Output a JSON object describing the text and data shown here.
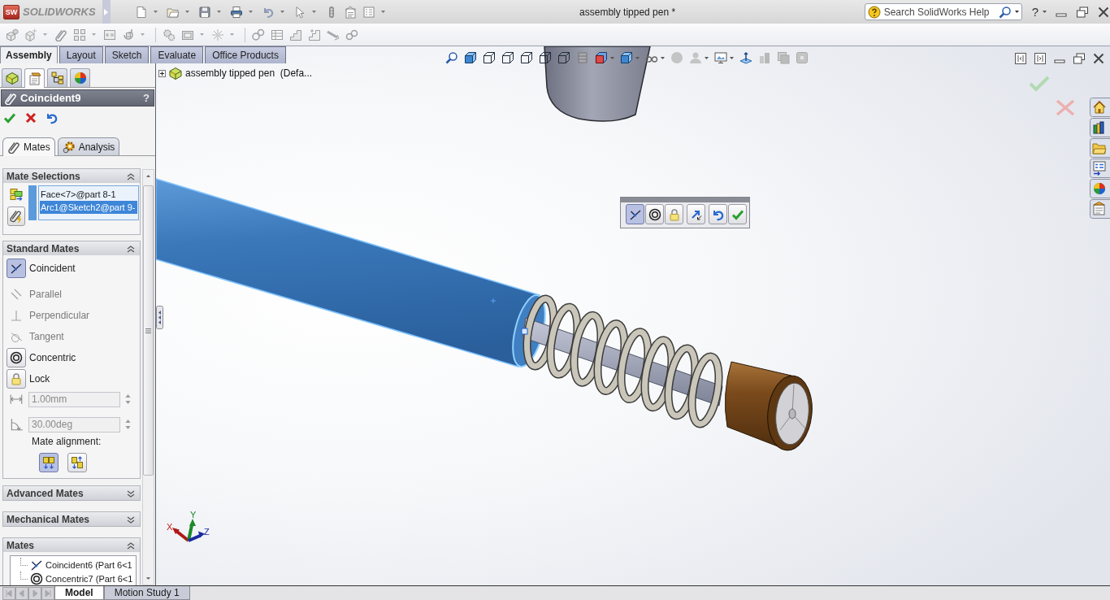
{
  "window": {
    "logo_mark": "SW",
    "brand": "SOLIDWORKS",
    "title": "assembly tipped pen *",
    "help": "?"
  },
  "help_search": {
    "placeholder": "Search SolidWorks Help"
  },
  "command_toolbar": {
    "disabled": true
  },
  "command_tabs": [
    {
      "label": "Assembly",
      "selected": true
    },
    {
      "label": "Layout",
      "selected": false
    },
    {
      "label": "Sketch",
      "selected": false
    },
    {
      "label": "Evaluate",
      "selected": false
    },
    {
      "label": "Office Products",
      "selected": false
    }
  ],
  "manager_tabs": [
    {
      "selected": false
    },
    {
      "selected": true
    },
    {
      "selected": false
    },
    {
      "selected": false
    }
  ],
  "property_manager": {
    "title": "Coincident9",
    "help": "?",
    "tabs": [
      {
        "label": "Mates",
        "selected": true
      },
      {
        "label": "Analysis",
        "selected": false
      }
    ],
    "mate_selections": {
      "title": "Mate Selections",
      "expanded": true,
      "items": [
        {
          "text": "Face<7>@part 8-1",
          "selected": false
        },
        {
          "text": "Arc1@Sketch2@part 9-",
          "selected": true
        }
      ]
    },
    "standard_mates": {
      "title": "Standard Mates",
      "expanded": true,
      "options": [
        {
          "kind": "coincident",
          "label": "Coincident",
          "selected": true,
          "disabled": false
        },
        {
          "kind": "parallel",
          "label": "Parallel",
          "selected": false,
          "disabled": true
        },
        {
          "kind": "perpendicular",
          "label": "Perpendicular",
          "selected": false,
          "disabled": true
        },
        {
          "kind": "tangent",
          "label": "Tangent",
          "selected": false,
          "disabled": true
        },
        {
          "kind": "concentric",
          "label": "Concentric",
          "selected": false,
          "disabled": false
        },
        {
          "kind": "lock",
          "label": "Lock",
          "selected": false,
          "disabled": false
        }
      ],
      "distance": {
        "value": "1.00mm",
        "disabled": true
      },
      "angle": {
        "value": "30.00deg",
        "disabled": true
      },
      "alignment_label": "Mate alignment:",
      "alignment": [
        {
          "kind": "aligned",
          "selected": true
        },
        {
          "kind": "anti_aligned",
          "selected": false
        }
      ]
    },
    "advanced_mates": {
      "title": "Advanced Mates",
      "expanded": false
    },
    "mechanical_mates": {
      "title": "Mechanical Mates",
      "expanded": false
    },
    "mates": {
      "title": "Mates",
      "expanded": true,
      "items": [
        {
          "kind": "coincident",
          "label": "Coincident6 (Part 6<1"
        },
        {
          "kind": "concentric",
          "label": "Concentric7 (Part 6<1"
        }
      ]
    }
  },
  "feature_tree": {
    "root": "assembly tipped pen  (Defa...",
    "expanded": false
  },
  "mate_popup": {
    "mates": [
      {
        "kind": "coincident",
        "selected": true
      },
      {
        "kind": "concentric",
        "selected": false
      },
      {
        "kind": "lock",
        "selected": false
      }
    ]
  },
  "triad": {
    "x": "X",
    "y": "Y",
    "z": "Z"
  },
  "bottom_tabs": [
    {
      "label": "Model",
      "selected": true
    },
    {
      "label": "Motion Study 1",
      "selected": false
    }
  ]
}
